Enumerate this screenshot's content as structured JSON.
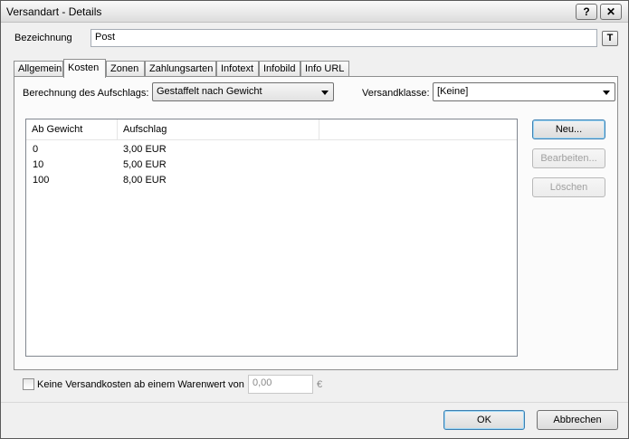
{
  "window": {
    "title": "Versandart - Details",
    "help_label": "?",
    "close_label": "✕"
  },
  "bezeichnung": {
    "label": "Bezeichnung",
    "value": "Post",
    "translate_button": "T"
  },
  "tabs": [
    {
      "label": "Allgemein"
    },
    {
      "label": "Kosten"
    },
    {
      "label": "Zonen"
    },
    {
      "label": "Zahlungsarten"
    },
    {
      "label": "Infotext"
    },
    {
      "label": "Infobild"
    },
    {
      "label": "Info URL"
    }
  ],
  "active_tab": "Kosten",
  "kosten": {
    "berechnung_label": "Berechnung des Aufschlags:",
    "berechnung_value": "Gestaffelt nach Gewicht",
    "versandklasse_label": "Versandklasse:",
    "versandklasse_value": "[Keine]",
    "table": {
      "columns": [
        "Ab Gewicht",
        "Aufschlag"
      ],
      "rows": [
        [
          "0",
          "3,00 EUR"
        ],
        [
          "10",
          "5,00 EUR"
        ],
        [
          "100",
          "8,00 EUR"
        ]
      ]
    },
    "buttons": {
      "neu": "Neu...",
      "bearbeiten": "Bearbeiten...",
      "loeschen": "Löschen"
    }
  },
  "free_shipping": {
    "checkbox_label": "Keine Versandkosten ab einem Warenwert von",
    "value": "0,00",
    "currency": "€",
    "checked": false
  },
  "footer": {
    "ok": "OK",
    "abbrechen": "Abbrechen"
  }
}
